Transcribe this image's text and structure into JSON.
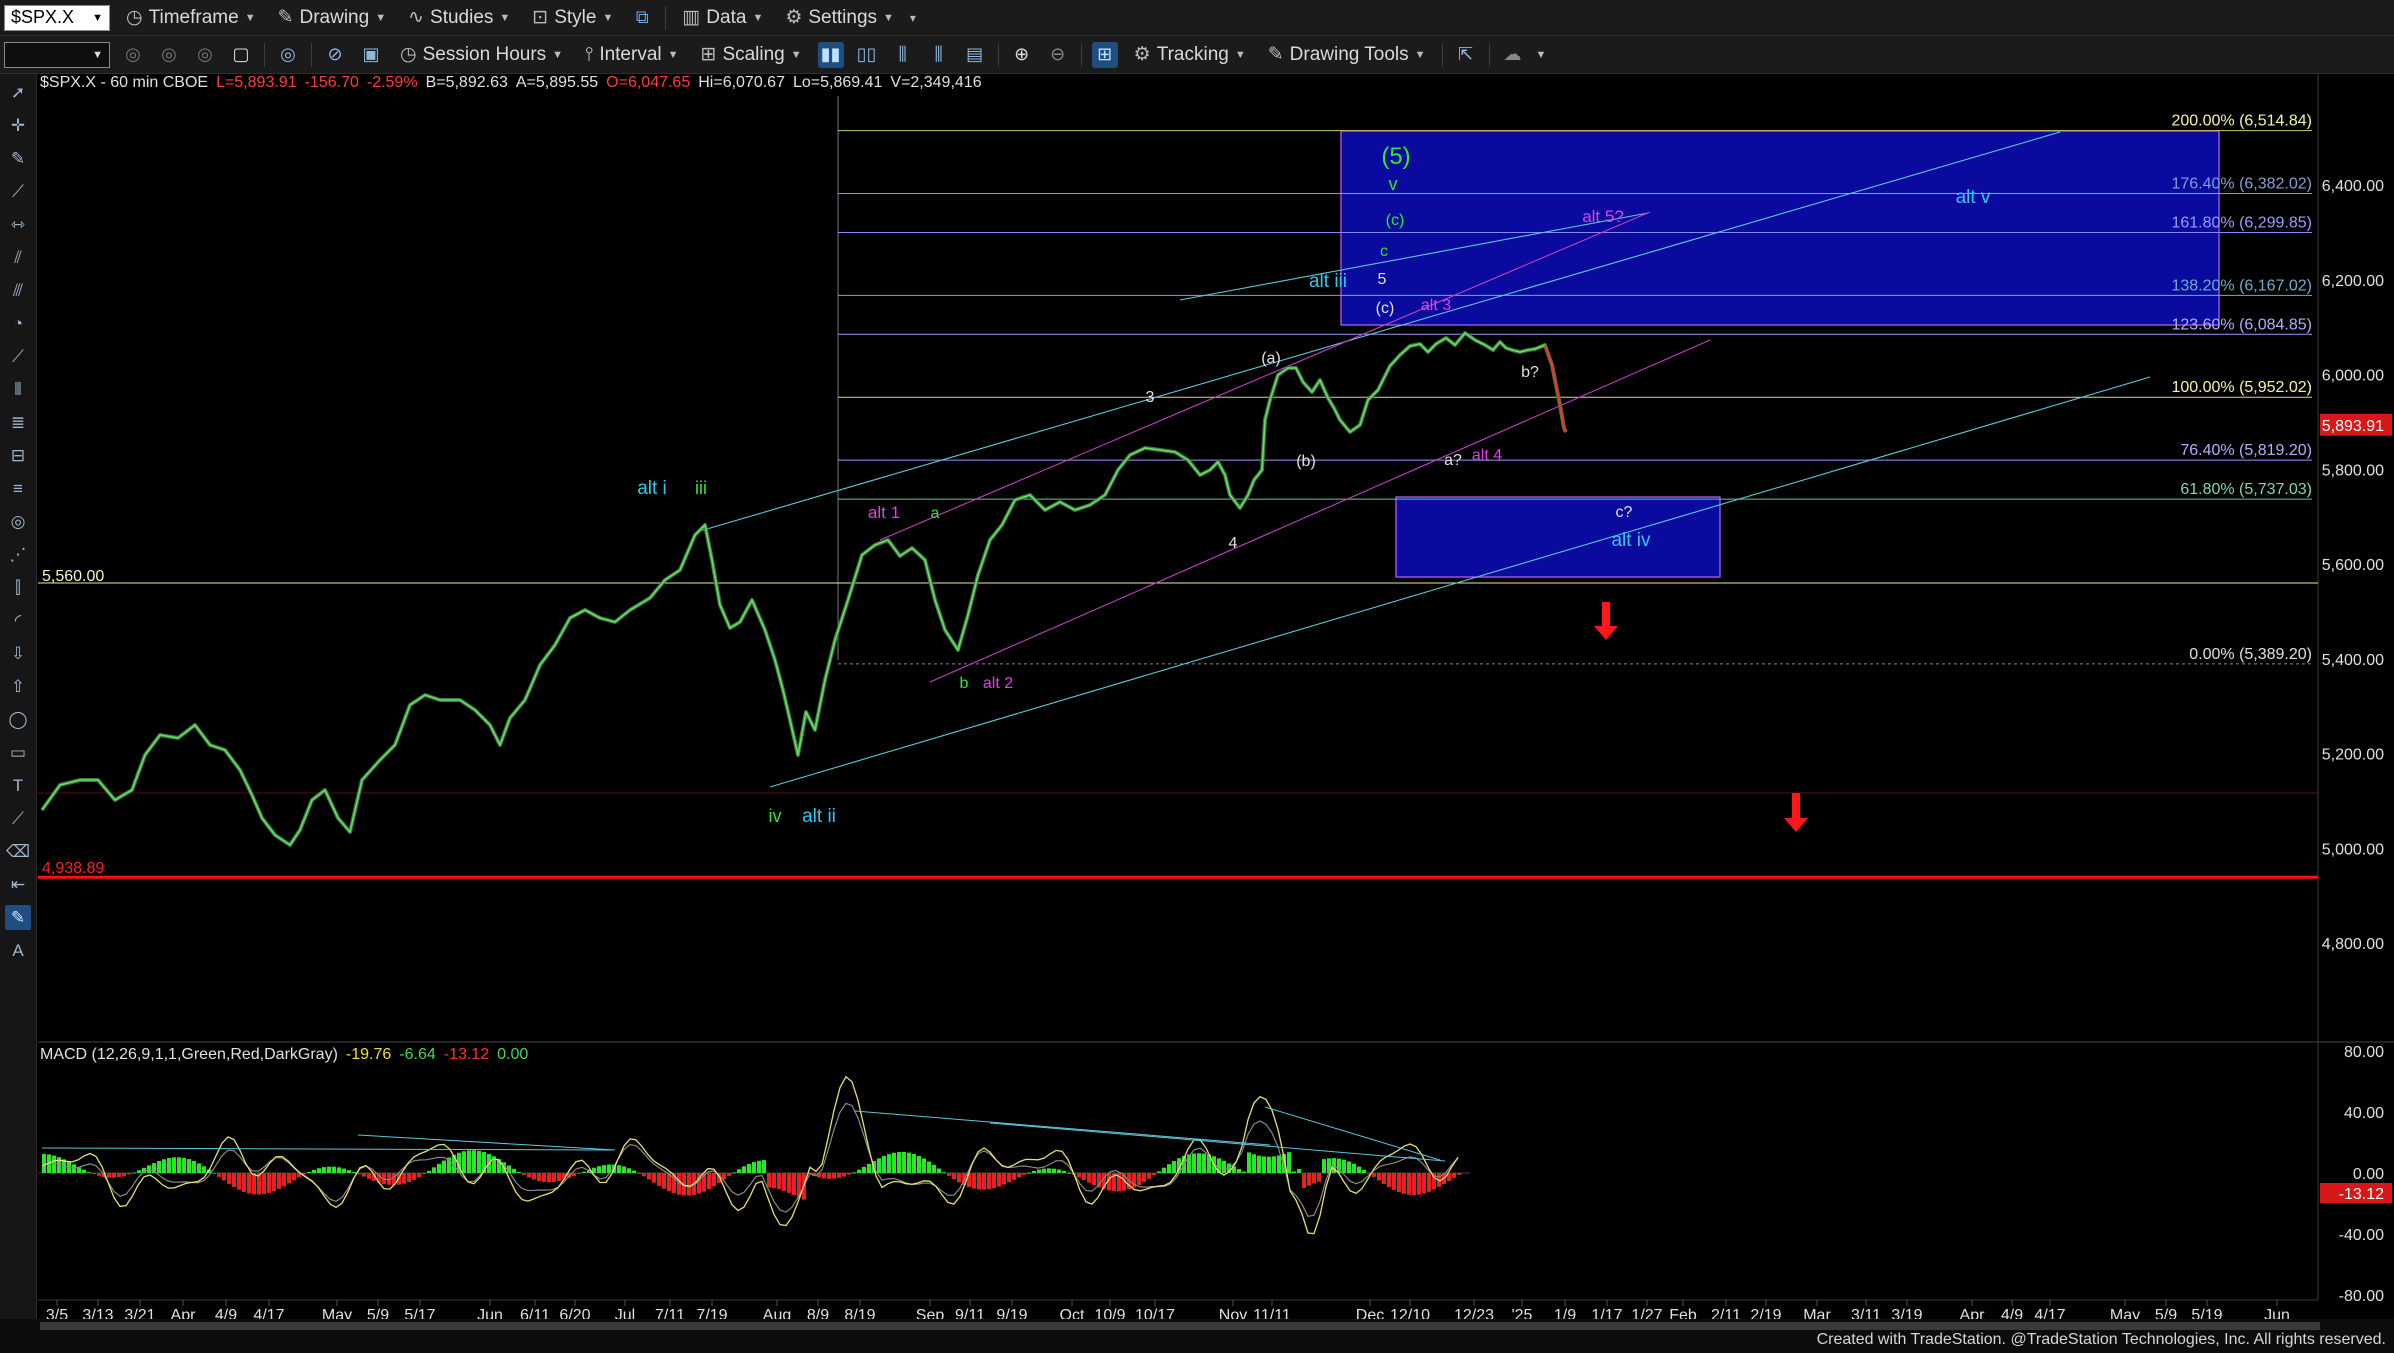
{
  "toolbar_top": {
    "symbol": "$SPX.X",
    "items": [
      {
        "label": "Timeframe",
        "icon": "clock-icon"
      },
      {
        "label": "Drawing",
        "icon": "pencil-icon"
      },
      {
        "label": "Studies",
        "icon": "studies-icon"
      },
      {
        "label": "Style",
        "icon": "style-icon"
      },
      {
        "label": "Data",
        "icon": "data-icon"
      },
      {
        "label": "Settings",
        "icon": "gear-icon"
      }
    ]
  },
  "toolbar_second": {
    "session_label": "Session Hours",
    "interval_label": "Interval",
    "scaling_label": "Scaling",
    "tracking_label": "Tracking",
    "drawing_tools_label": "Drawing Tools"
  },
  "chart_header": {
    "symbol_desc": "$SPX.X - 60 min CBOE",
    "last": "L=5,893.91",
    "change": "-156.70",
    "change_pct": "-2.59%",
    "bid": "B=5,892.63",
    "ask": "A=5,895.55",
    "open": "O=6,047.65",
    "high": "Hi=6,070.67",
    "low": "Lo=5,869.41",
    "volume": "V=2,349,416"
  },
  "price_axis": {
    "ticks": [
      "6,400.00",
      "6,200.00",
      "6,000.00",
      "5,800.00",
      "5,600.00",
      "5,400.00",
      "5,200.00",
      "5,000.00",
      "4,800.00"
    ],
    "last_price": "5,893.91",
    "last_price_color": "#d81818"
  },
  "levels": [
    {
      "label": "5,560.00",
      "color": "#f5f5c0"
    },
    {
      "label": "4,938.89",
      "color": "#ff2020"
    }
  ],
  "fib_levels": [
    {
      "label": "200.00% (6,514.84)",
      "color": "#f5f5a0"
    },
    {
      "label": "176.40% (6,382.02)",
      "color": "#7ea0d8"
    },
    {
      "label": "161.80% (6,299.85)",
      "color": "#9c9cff"
    },
    {
      "label": "138.20% (6,167.02)",
      "color": "#6ab0c8"
    },
    {
      "label": "123.60% (6,084.85)",
      "color": "#b0b0ff"
    },
    {
      "label": "100.00% (5,952.02)",
      "color": "#f5f5a0"
    },
    {
      "label": "76.40% (5,819.20)",
      "color": "#b0b0ff"
    },
    {
      "label": "61.80% (5,737.03)",
      "color": "#7fd8b0"
    },
    {
      "label": "0.00% (5,389.20)",
      "color": "#e0e0e0"
    }
  ],
  "wave_labels": [
    {
      "text": "(5)",
      "color": "#2ee82e"
    },
    {
      "text": "v",
      "color": "#2ee82e"
    },
    {
      "text": "(c)",
      "color": "#2ee82e"
    },
    {
      "text": "c",
      "color": "#2ee82e"
    },
    {
      "text": "5",
      "color": "#e0e0e0"
    },
    {
      "text": "(c)",
      "color": "#e0e0e0"
    },
    {
      "text": "alt 3",
      "color": "#e040e0"
    },
    {
      "text": "alt iii",
      "color": "#30c8f0"
    },
    {
      "text": "alt 5?",
      "color": "#e040e0"
    },
    {
      "text": "alt v",
      "color": "#30c8f0"
    },
    {
      "text": "(a)",
      "color": "#e0e0e0"
    },
    {
      "text": "3",
      "color": "#e0e0e0"
    },
    {
      "text": "b?",
      "color": "#e0e0e0"
    },
    {
      "text": "(b)",
      "color": "#e0e0e0"
    },
    {
      "text": "a?",
      "color": "#e0e0e0"
    },
    {
      "text": "alt 4",
      "color": "#e040e0"
    },
    {
      "text": "c?",
      "color": "#e0e0e0"
    },
    {
      "text": "alt iv",
      "color": "#30c8f0"
    },
    {
      "text": "4",
      "color": "#e0e0e0"
    },
    {
      "text": "alt 1",
      "color": "#e040e0"
    },
    {
      "text": "a",
      "color": "#2ee82e"
    },
    {
      "text": "alt i",
      "color": "#30c8f0"
    },
    {
      "text": "iii",
      "color": "#2ee82e"
    },
    {
      "text": "b",
      "color": "#2ee82e"
    },
    {
      "text": "alt 2",
      "color": "#e040e0"
    },
    {
      "text": "iv",
      "color": "#2ee82e"
    },
    {
      "text": "alt ii",
      "color": "#30c8f0"
    }
  ],
  "time_axis": [
    "3/5",
    "3/13",
    "3/21",
    "Apr",
    "4/9",
    "4/17",
    "May",
    "5/9",
    "5/17",
    "Jun",
    "6/11",
    "6/20",
    "Jul",
    "7/11",
    "7/19",
    "Aug",
    "8/9",
    "8/19",
    "Sep",
    "9/11",
    "9/19",
    "Oct",
    "10/9",
    "10/17",
    "Nov",
    "11/11",
    "Dec",
    "12/10",
    "12/23",
    "'25",
    "1/9",
    "1/17",
    "1/27",
    "Feb",
    "2/11",
    "2/19",
    "Mar",
    "3/11",
    "3/19",
    "Apr",
    "4/9",
    "4/17",
    "May",
    "5/9",
    "5/19",
    "Jun"
  ],
  "macd": {
    "title": "MACD (12,26,9,1,1,Green,Red,DarkGray)",
    "v1": "-19.76",
    "v2": "-6.64",
    "v3": "-13.12",
    "v4": "0.00",
    "ticks": [
      "80.00",
      "40.00",
      "0.00",
      "-40.00",
      "-80.00"
    ],
    "last": "-13.12"
  },
  "footer": "Created with TradeStation. @TradeStation Technologies, Inc. All rights reserved."
}
